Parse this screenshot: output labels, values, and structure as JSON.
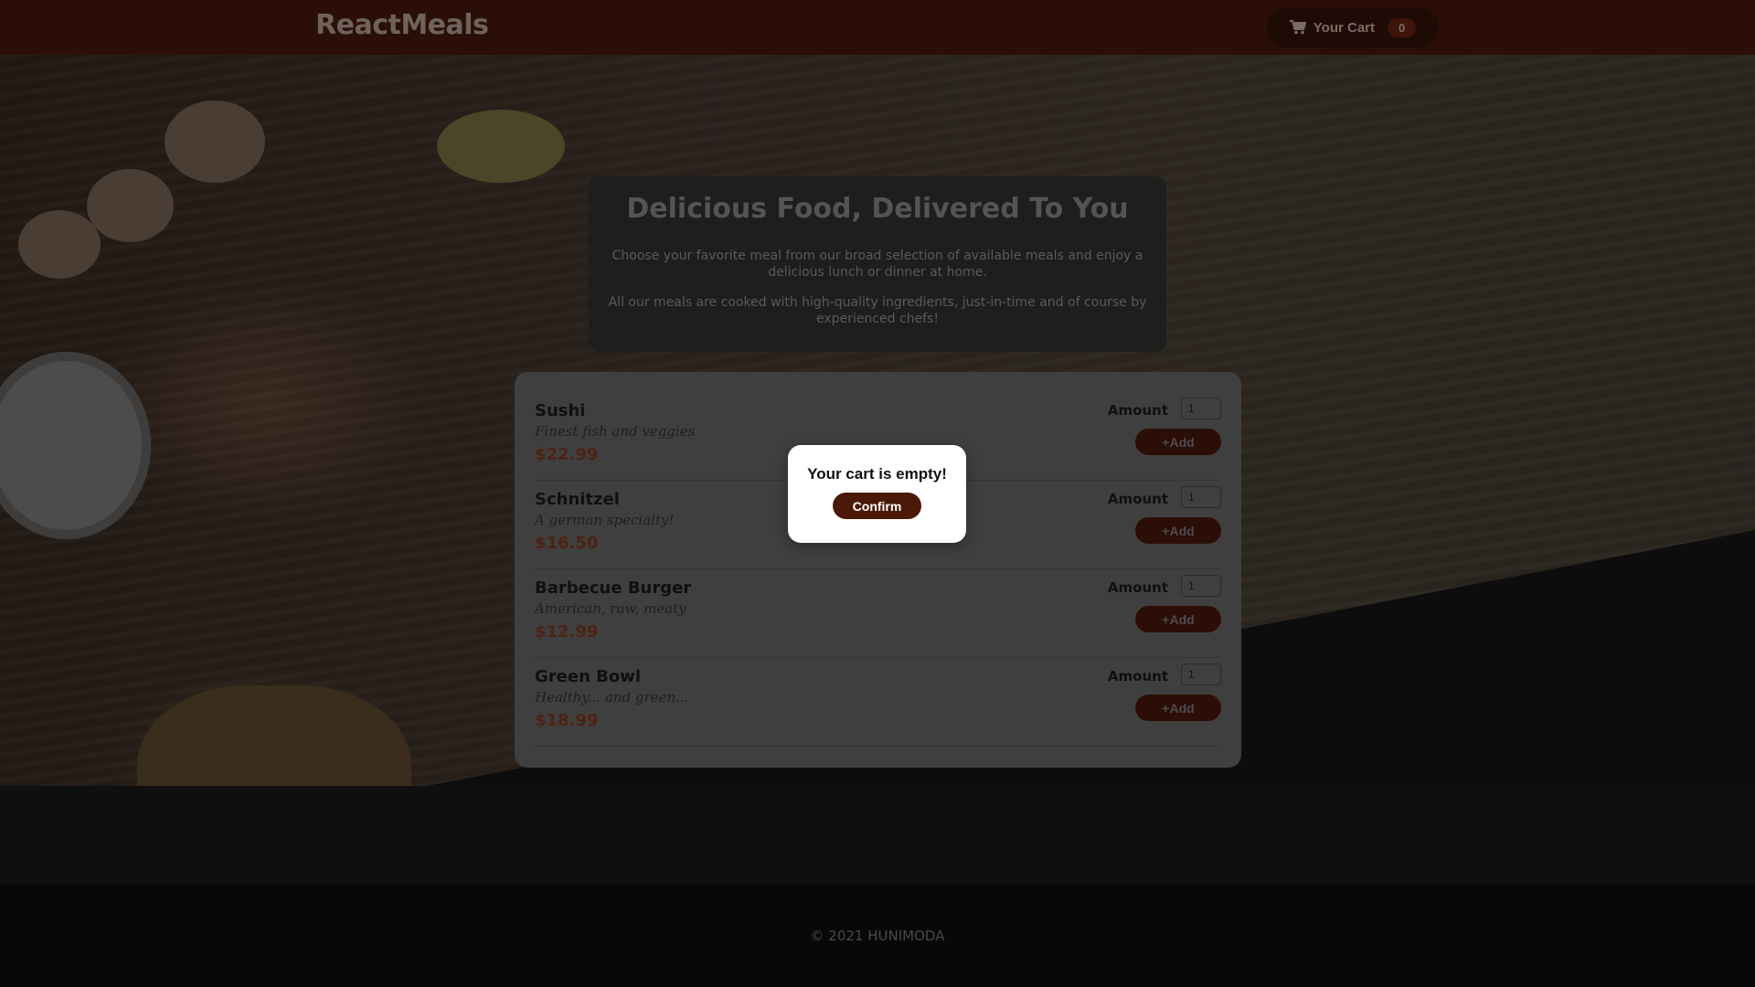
{
  "header": {
    "logo": "ReactMeals",
    "cart_label": "Your Cart",
    "cart_count": "0"
  },
  "summary": {
    "title": "Delicious Food, Delivered To You",
    "p1": "Choose your favorite meal from our broad selection of available meals and enjoy a delicious lunch or dinner at home.",
    "p2": "All our meals are cooked with high-quality ingredients, just-in-time and of course by experienced chefs!"
  },
  "meals": [
    {
      "name": "Sushi",
      "description": "Finest fish and veggies",
      "price": "$22.99",
      "amount_label": "Amount",
      "amount": "1",
      "add_label": "+Add"
    },
    {
      "name": "Schnitzel",
      "description": "A german specialty!",
      "price": "$16.50",
      "amount_label": "Amount",
      "amount": "1",
      "add_label": "+Add"
    },
    {
      "name": "Barbecue Burger",
      "description": "American, raw, meaty",
      "price": "$12.99",
      "amount_label": "Amount",
      "amount": "1",
      "add_label": "+Add"
    },
    {
      "name": "Green Bowl",
      "description": "Healthy... and green...",
      "price": "$18.99",
      "amount_label": "Amount",
      "amount": "1",
      "add_label": "+Add"
    }
  ],
  "modal": {
    "message": "Your cart is empty!",
    "confirm_label": "Confirm"
  },
  "footer": {
    "text": "© 2021 HUNIMODA"
  },
  "colors": {
    "header_bg": "#2b0f06",
    "accent": "#4a1908",
    "price": "#4e2213"
  },
  "icons": {
    "cart": "cart-icon"
  }
}
